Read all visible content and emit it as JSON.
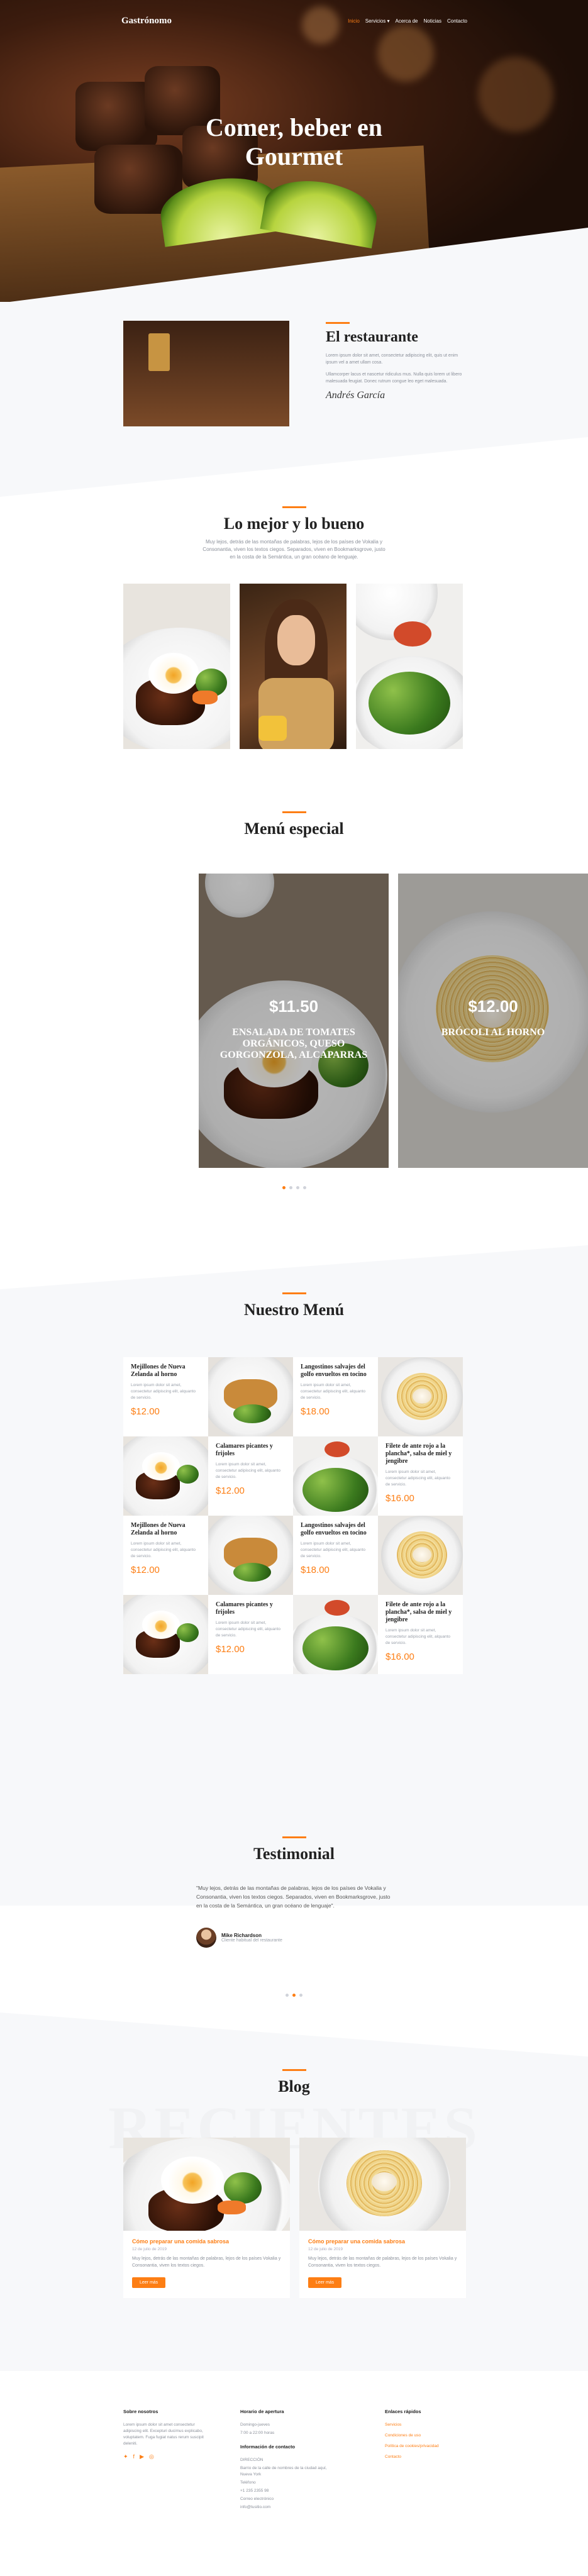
{
  "nav": {
    "logo": "Gastrónomo",
    "items": [
      "Inicio",
      "Servicios ▾",
      "Acerca de",
      "Noticias",
      "Contacto"
    ]
  },
  "hero": {
    "title_line1": "Comer, beber en",
    "title_line2": "Gourmet"
  },
  "about": {
    "title": "El restaurante",
    "p1": "Lorem ipsum dolor sit amet, consectetur adipiscing elit, quis ut enim ipsum vel a amet ullam cosa.",
    "p2": "Ullamcorper lacus et nascetur ridiculus mus. Nulla quis lorem ut libero malesuada feugiat. Donec rutrum congue leo eget malesuada.",
    "signature": "Andrés García"
  },
  "best": {
    "title": "Lo mejor y lo bueno",
    "text": "Muy lejos, detrás de las montañas de palabras, lejos de los países de Vokalia y Consonantia, viven los textos ciegos. Separados, viven en Bookmarksgrove, justo en la costa de la Semántica, un gran océano de lenguaje."
  },
  "special": {
    "title": "Menú especial",
    "slides": [
      {
        "price": "$11.50",
        "name": "ENSALADA DE TOMATES ORGÁNICOS, QUESO GORGONZOLA, ALCAPARRAS"
      },
      {
        "price": "$12.00",
        "name": "BRÓCOLI AL HORNO"
      }
    ]
  },
  "menu": {
    "title": "Nuestro Menú",
    "desc": "Lorem ipsum dolor sit amet, consectetur adipiscing elit, alquanto de servicio.",
    "items": [
      {
        "name": "Mejillones de Nueva Zelanda al horno",
        "price": "$12.00"
      },
      {
        "name": "Langostinos salvajes del golfo envueltos en tocino",
        "price": "$18.00"
      },
      {
        "name": "Calamares picantes y frijoles",
        "price": "$12.00"
      },
      {
        "name": "Filete de ante rojo a la plancha*, salsa de miel y jengibre",
        "price": "$16.00"
      },
      {
        "name": "Mejillones de Nueva Zelanda al horno",
        "price": "$12.00"
      },
      {
        "name": "Langostinos salvajes del golfo envueltos en tocino",
        "price": "$18.00"
      },
      {
        "name": "Calamares picantes y frijoles",
        "price": "$12.00"
      },
      {
        "name": "Filete de ante rojo a la plancha*, salsa de miel y jengibre",
        "price": "$16.00"
      }
    ]
  },
  "testimonial": {
    "title": "Testimonial",
    "quote": "\"Muy lejos, detrás de las montañas de palabras, lejos de los países de Vokalia y Consonantia, viven los textos ciegos. Separados, viven en Bookmarksgrove, justo en la costa de la Semántica, un gran océano de lenguaje\".",
    "name": "Mike Richardson",
    "role": "Cliente habitual del restaurante"
  },
  "blog": {
    "title": "Blog",
    "ghost": "RECIENTES",
    "posts": [
      {
        "title": "Cómo preparar una comida sabrosa",
        "date": "12 de julio de 2019",
        "text": "Muy lejos, detrás de las montañas de palabras, lejos de los países Vokalia y Consonantia, viven los textos ciegos.",
        "button": "Leer más"
      },
      {
        "title": "Cómo preparar una comida sabrosa",
        "date": "12 de julio de 2019",
        "text": "Muy lejos, detrás de las montañas de palabras, lejos de los países Vokalia y Consonantia, viven los textos ciegos.",
        "button": "Leer más"
      }
    ]
  },
  "footer": {
    "about_title": "Sobre nosotros",
    "about_text": "Lorem ipsum dolor sit amet consectetur adipiscing elit. Excepturi ducimus explicabo, voluptatem. Fuga fugiat natus rerum suscipit deleniti.",
    "hours_title": "Horario de apertura",
    "hours_days": "Domingo-jueves",
    "hours_time": "7:00 a 22:00 horas",
    "contact_title": "Información de contacto",
    "address_label": "DIRECCIÓN",
    "address": "Barrio de la calle de nombres de la ciudad aquí, Nueva York",
    "phone_label": "Teléfono",
    "phone": "+1 235 2355 98",
    "email_label": "Correo electrónico",
    "email": "info@tusitio.com",
    "links_title": "Enlaces rápidos",
    "links": [
      "Servicios",
      "Condiciones de uso",
      "Política de cookies/privacidad",
      "Contacto"
    ],
    "social_icons": [
      "twitter-icon",
      "facebook-icon",
      "youtube-icon",
      "instagram-icon"
    ]
  },
  "colors": {
    "accent": "#fd7e14",
    "dark": "#222222",
    "muted": "#8a8f99",
    "bg_soft": "#f7f8fa"
  }
}
